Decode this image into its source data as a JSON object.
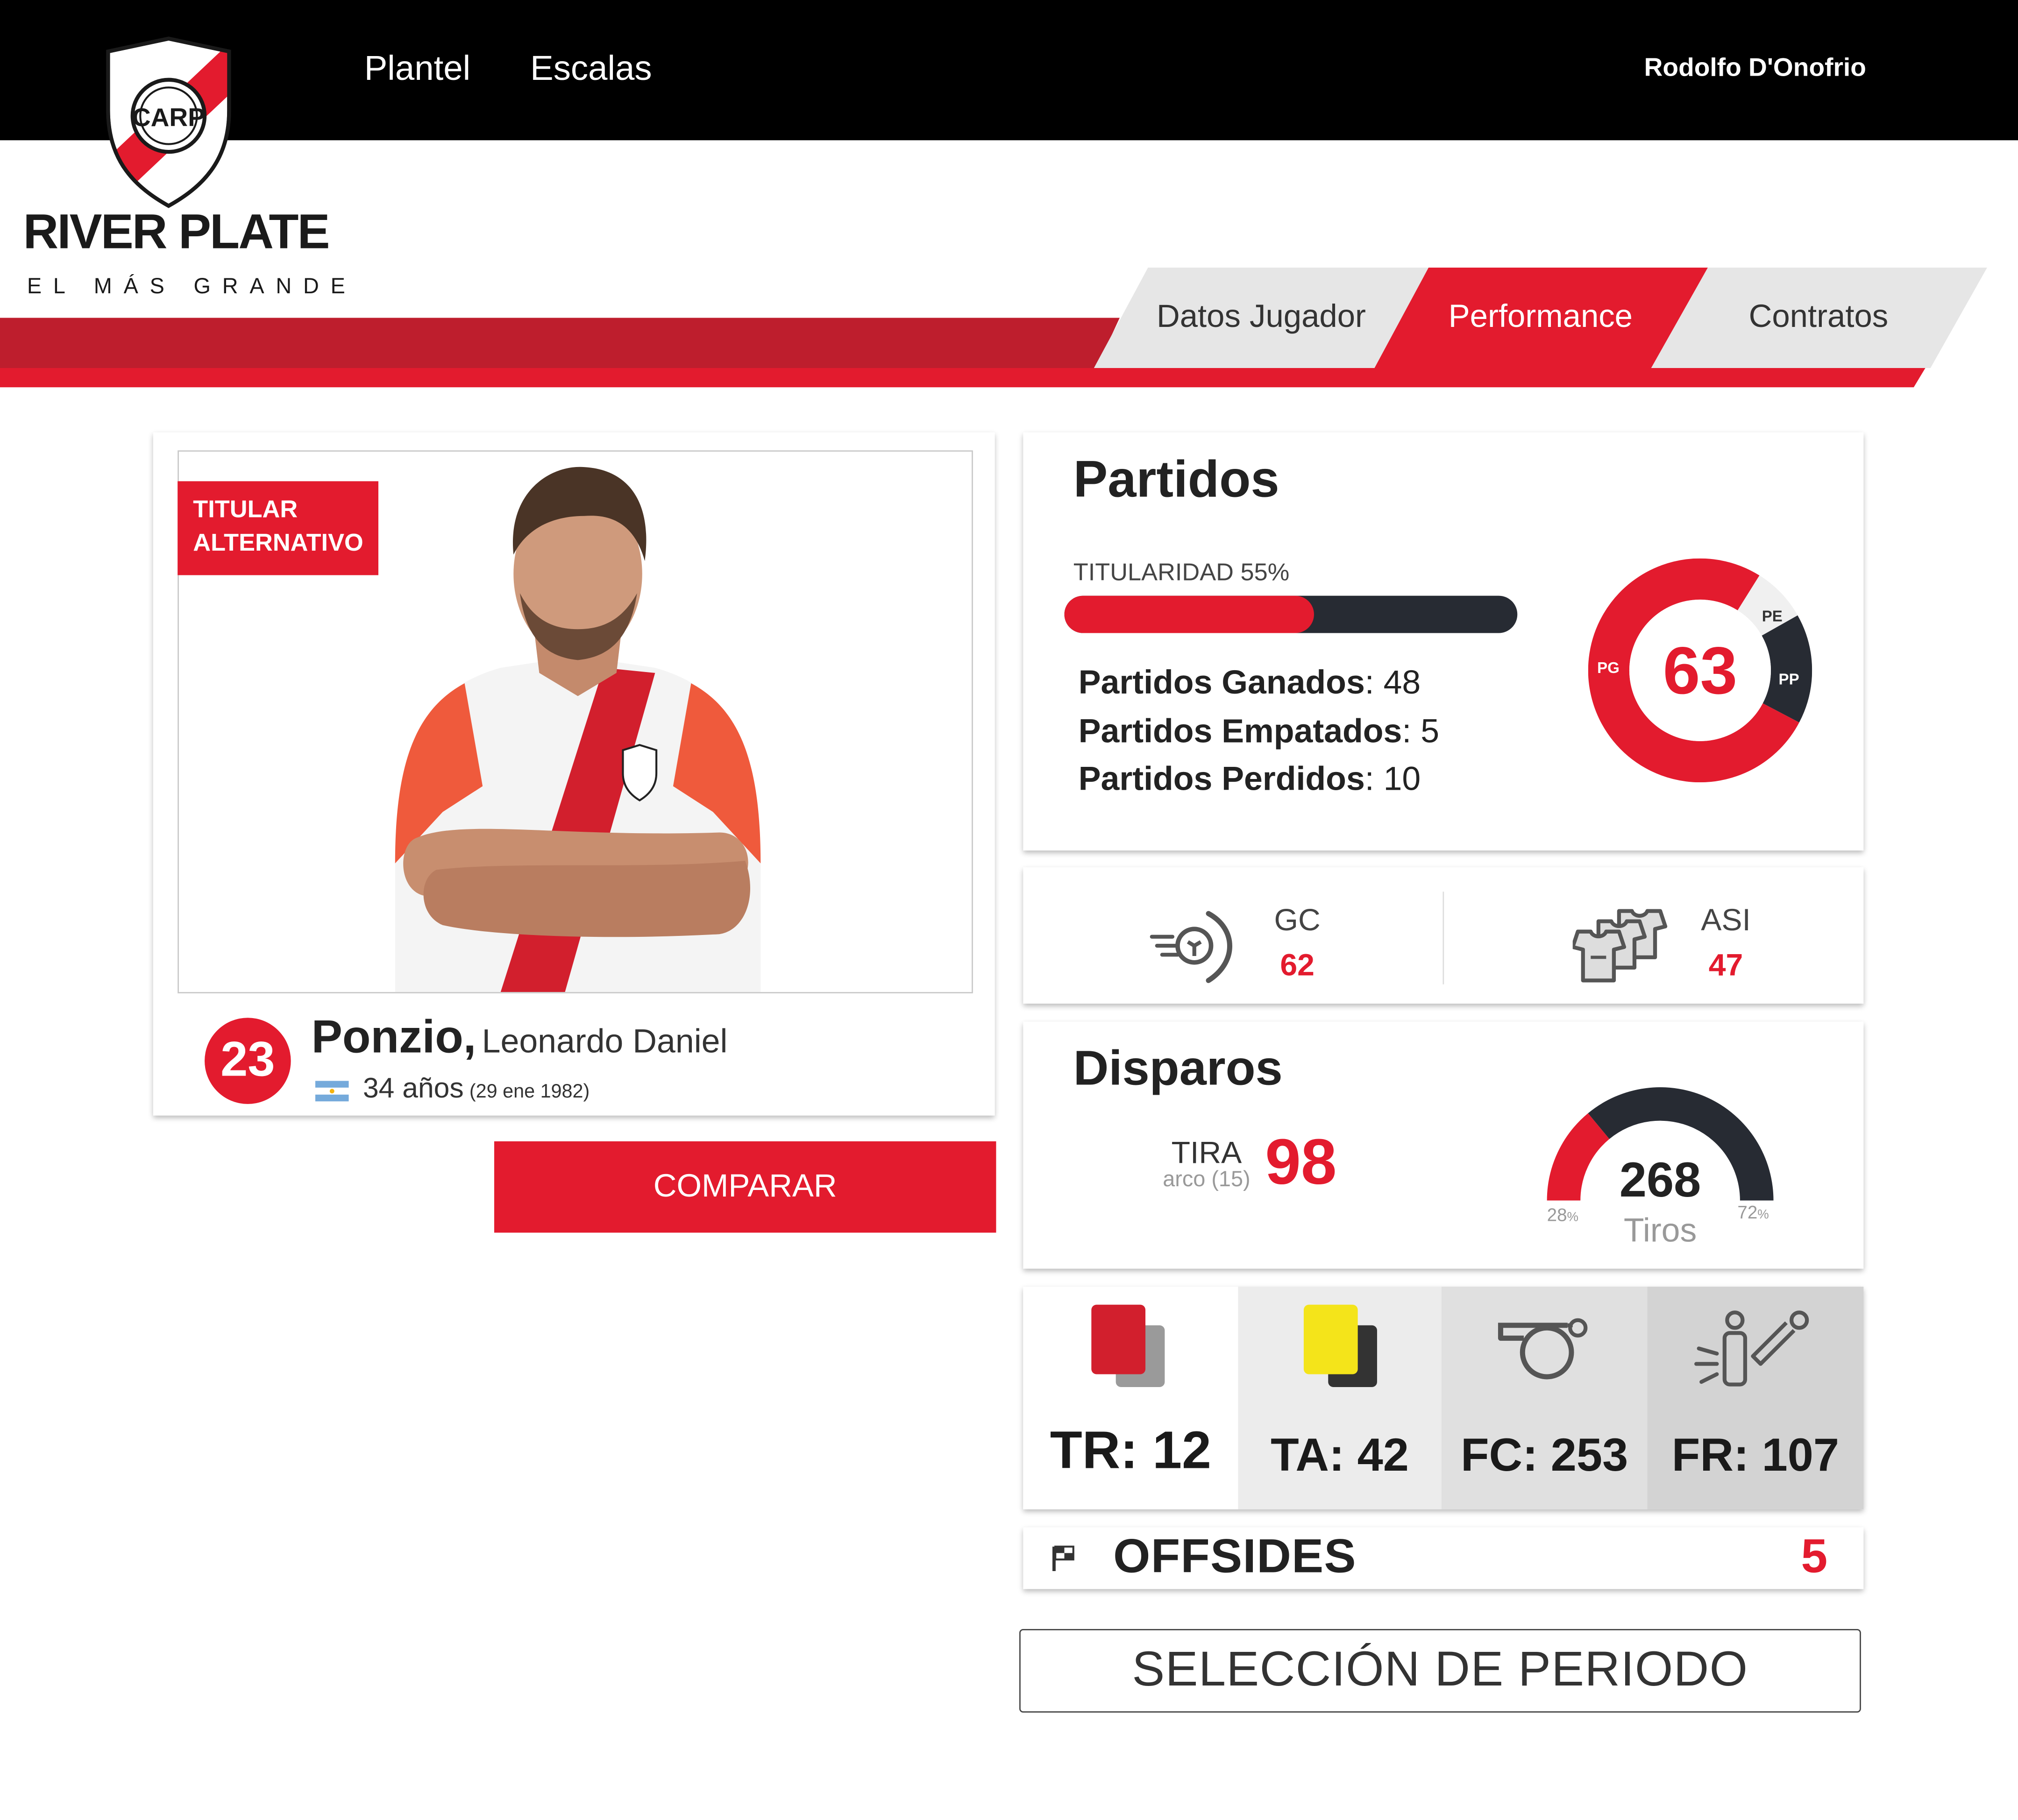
{
  "header": {
    "brand": {
      "name": "RIVER PLATE",
      "tagline": "EL MÁS GRANDE",
      "crest_text": "CARP"
    },
    "nav": [
      {
        "label": "Plantel"
      },
      {
        "label": "Escalas"
      }
    ],
    "user": "Rodolfo D'Onofrio",
    "tabs": [
      {
        "label": "Datos Jugador",
        "active": false
      },
      {
        "label": "Performance",
        "active": true
      },
      {
        "label": "Contratos",
        "active": false
      }
    ],
    "colors": {
      "top_bar": "#000000",
      "accent": "#e31b2e",
      "accent_dark": "#be1e2d",
      "tab_inactive": "#e6e6e6"
    }
  },
  "player": {
    "status_badge": [
      "TITULAR",
      "ALTERNATIVO"
    ],
    "number": "23",
    "last_name": "Ponzio,",
    "first_names": "Leonardo Daniel",
    "age": "34 años",
    "birth": "(29 ene 1982)",
    "nationality_flag": "argentina-flag-icon"
  },
  "compare_button": "COMPARAR",
  "matches": {
    "title": "Partidos",
    "ownership_label": "TITULARIDAD 55%",
    "ownership_value": 55,
    "rows": [
      {
        "label": "Partidos Ganados",
        "value": ": 48"
      },
      {
        "label": "Partidos Empatados",
        "value": ": 5"
      },
      {
        "label": "Partidos Perdidos",
        "value": ": 10"
      }
    ],
    "donut": {
      "total": "63",
      "segments": [
        {
          "key": "PG",
          "value": 48,
          "color": "#e31b2e"
        },
        {
          "key": "PE",
          "value": 5,
          "color": "#f0f0f0"
        },
        {
          "key": "PP",
          "value": 10,
          "color": "#272b33"
        }
      ]
    }
  },
  "goals": {
    "label": "GC",
    "value": "62",
    "icon": "goal-shot-icon"
  },
  "assists": {
    "label": "ASI",
    "value": "47",
    "icon": "jerseys-icon"
  },
  "shots": {
    "title": "Disparos",
    "on_target_label": "TIRA",
    "on_target_sub": "arco (15)",
    "on_target_value": "98",
    "total": "268",
    "total_label": "Tiros",
    "left_pct": "28",
    "right_pct": "72",
    "pct_suffix": "%",
    "left_value": 28,
    "colors": {
      "left": "#e31b2e",
      "right": "#272b33"
    }
  },
  "discipline": [
    {
      "label": "TR: 12",
      "icon": "red-card-icon"
    },
    {
      "label": "TA: 42",
      "icon": "yellow-card-icon"
    },
    {
      "label": "FC: 253",
      "icon": "whistle-icon"
    },
    {
      "label": "FR: 107",
      "icon": "foul-received-icon"
    }
  ],
  "offsides": {
    "label": "OFFSIDES",
    "value": "5",
    "icon": "flag-icon"
  },
  "period_button": "SELECCIÓN DE PERIODO"
}
